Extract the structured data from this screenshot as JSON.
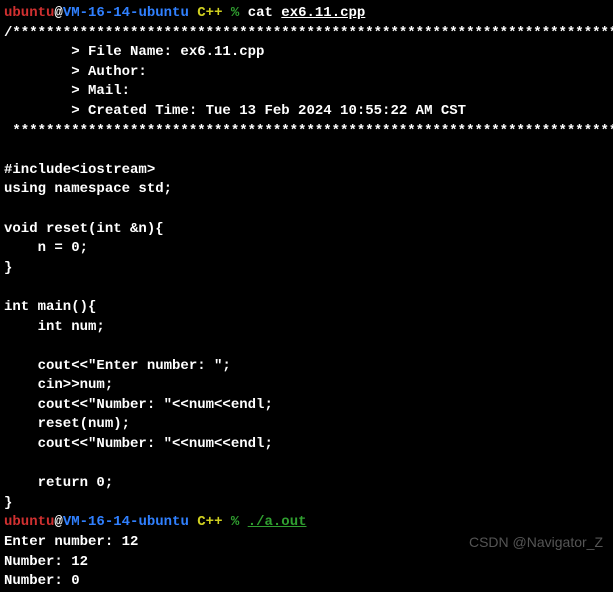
{
  "prompt1": {
    "user": "ubuntu",
    "at": "@",
    "host": "VM-16-14-ubuntu",
    "path": " C++",
    "symbol": " % ",
    "command": "cat ",
    "arg": "ex6.11.cpp"
  },
  "code": {
    "l01": "/*************************************************************************",
    "l02": "        > File Name: ex6.11.cpp",
    "l03": "        > Author:",
    "l04": "        > Mail:",
    "l05": "        > Created Time: Tue 13 Feb 2024 10:55:22 AM CST",
    "l06": " ************************************************************************/",
    "l07": "",
    "l08": "#include<iostream>",
    "l09": "using namespace std;",
    "l10": "",
    "l11": "void reset(int &n){",
    "l12": "    n = 0;",
    "l13": "}",
    "l14": "",
    "l15": "int main(){",
    "l16": "    int num;",
    "l17": "",
    "l18": "    cout<<\"Enter number: \";",
    "l19": "    cin>>num;",
    "l20": "    cout<<\"Number: \"<<num<<endl;",
    "l21": "    reset(num);",
    "l22": "    cout<<\"Number: \"<<num<<endl;",
    "l23": "",
    "l24": "    return 0;",
    "l25": "}"
  },
  "prompt2": {
    "user": "ubuntu",
    "at": "@",
    "host": "VM-16-14-ubuntu",
    "path": " C++",
    "symbol": " % ",
    "command": "./a.out"
  },
  "output": {
    "l1": "Enter number: 12",
    "l2": "Number: 12",
    "l3": "Number: 0"
  },
  "watermark": "CSDN @Navigator_Z"
}
